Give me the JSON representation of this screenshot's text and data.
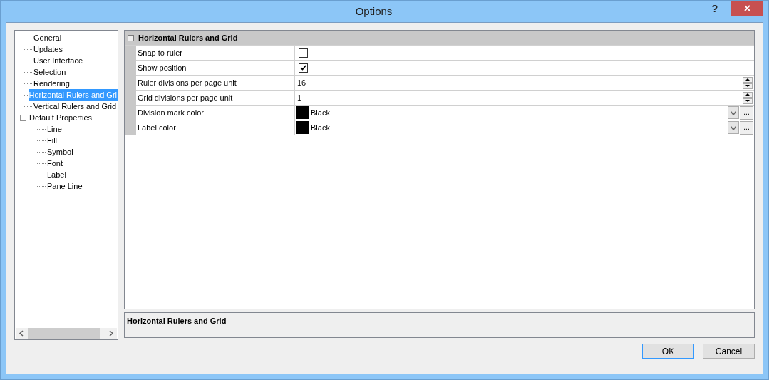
{
  "window": {
    "title": "Options",
    "help": "?",
    "close": "×"
  },
  "tree": [
    {
      "label": "General",
      "selected": false
    },
    {
      "label": "Updates",
      "selected": false
    },
    {
      "label": "User Interface",
      "selected": false
    },
    {
      "label": "Selection",
      "selected": false
    },
    {
      "label": "Rendering",
      "selected": false
    },
    {
      "label": "Horizontal Rulers and Gri",
      "selected": true
    },
    {
      "label": "Vertical Rulers and Grid",
      "selected": false
    },
    {
      "label": "Default Properties",
      "selected": false,
      "expanded": true,
      "children": [
        {
          "label": "Line",
          "selected": false
        },
        {
          "label": "Fill",
          "selected": false
        },
        {
          "label": "Symbol",
          "selected": false
        },
        {
          "label": "Font",
          "selected": false
        },
        {
          "label": "Label",
          "selected": false
        },
        {
          "label": "Pane Line",
          "selected": false
        }
      ]
    }
  ],
  "grid": {
    "category": "Horizontal Rulers and Grid",
    "expanded": true,
    "rows": [
      {
        "kind": "checkbox",
        "label": "Snap to ruler",
        "checked": false
      },
      {
        "kind": "checkbox",
        "label": "Show position",
        "checked": true
      },
      {
        "kind": "spinner",
        "label": "Ruler divisions per page unit",
        "value": "16"
      },
      {
        "kind": "spinner",
        "label": "Grid divisions per page unit",
        "value": "1"
      },
      {
        "kind": "color",
        "label": "Division mark color",
        "value": "Black",
        "color": "#000000",
        "more": "..."
      },
      {
        "kind": "color",
        "label": "Label color",
        "value": "Black",
        "color": "#000000",
        "more": "..."
      }
    ]
  },
  "description": "Horizontal Rulers and Grid",
  "buttons": [
    "OK",
    "Cancel"
  ]
}
